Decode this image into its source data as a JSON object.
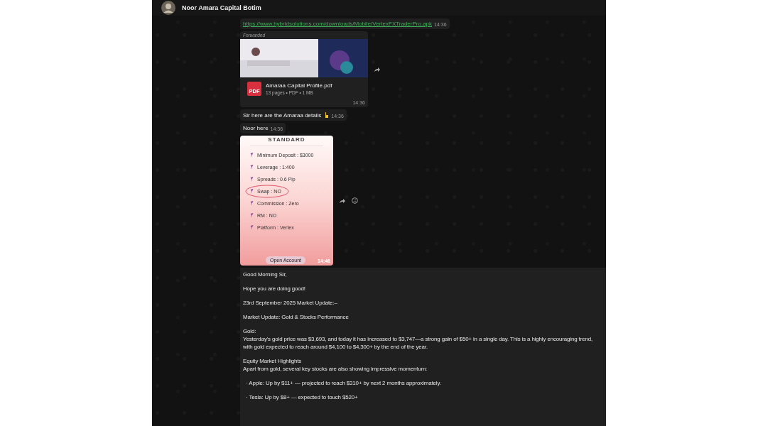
{
  "header": {
    "contact_name": "Noor Amara Capital Botim"
  },
  "messages": [
    {
      "kind": "link",
      "text": "https://www.hybridsolutions.com/downloads/Mobile/VertexFXTraderPro.apk",
      "time": "14:36"
    },
    {
      "kind": "document",
      "forwarded_label": "Forwarded",
      "file_name": "Amaraa Capital Profile.pdf",
      "file_badge": "PDF",
      "file_meta": "13 pages • PDF • 1 MB",
      "time": "14:36"
    },
    {
      "kind": "text",
      "text": "Sir here are the Amaraa details",
      "time": "14:36"
    },
    {
      "kind": "text",
      "text": "Noor here",
      "time": "14:36"
    },
    {
      "card_title": "STANDARD",
      "items": [
        {
          "text": "Minimum Deposit : $3000",
          "circled": false
        },
        {
          "text": "Leverage : 1:400",
          "circled": false
        },
        {
          "text": "Spreads : 0.6 Pip",
          "circled": false
        },
        {
          "text": "Swap : NO",
          "circled": true
        },
        {
          "text": "Commission : Zero",
          "circled": false
        },
        {
          "text": "RM : NO",
          "circled": false
        },
        {
          "text": "Platform : Vertex",
          "circled": false
        }
      ],
      "button": "Open Account",
      "time": "14:46"
    },
    {
      "kind": "long_text",
      "paragraphs": [
        "Good Morning Sir,",
        "Hope you are doing good!",
        "23rd September 2025 Market Update:–",
        "Market Update: Gold & Stocks Performance",
        "Gold:\nYesterday's gold price was $3,693, and today it has increased to $3,747—a strong gain of $50+ in a single day. This is a highly encouraging trend, with gold expected to reach around $4,100 to $4,300+ by the end of the year.",
        "Equity Market Highlights\nApart from gold, several key stocks are also showing impressive momentum:",
        "  · Apple: Up by $11+ — projected to reach $310+ by next 2 months approximately.",
        "  · Tesla: Up by $8+ — expected to touch $520+"
      ]
    }
  ]
}
